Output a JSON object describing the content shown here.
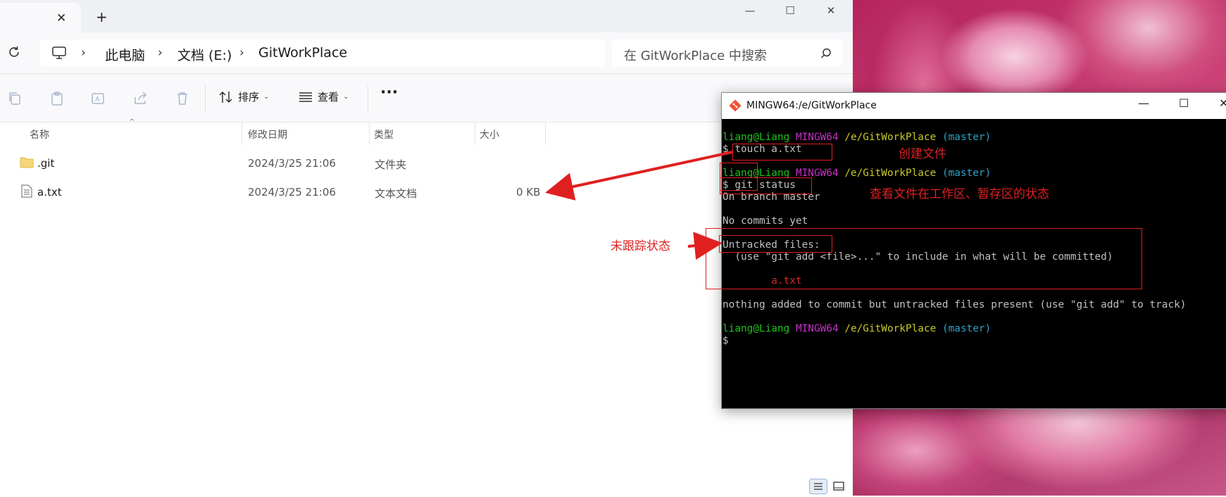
{
  "explorer": {
    "tab_close": "✕",
    "tab_add": "+",
    "window_controls": {
      "minimize": "—",
      "maximize": "☐",
      "close": "✕"
    },
    "breadcrumb": [
      "此电脑",
      "文档 (E:)",
      "GitWorkPlace"
    ],
    "search_placeholder": "在 GitWorkPlace 中搜索",
    "toolbar": {
      "sort_label": "排序",
      "view_label": "查看",
      "more_label": "···"
    },
    "columns": [
      "名称",
      "修改日期",
      "类型",
      "大小"
    ],
    "files": [
      {
        "name": ".git",
        "modified": "2024/3/25 21:06",
        "type": "文件夹",
        "size": "",
        "icon": "folder-icon"
      },
      {
        "name": "a.txt",
        "modified": "2024/3/25 21:06",
        "type": "文本文档",
        "size": "0 KB",
        "icon": "text-file-icon"
      }
    ]
  },
  "terminal": {
    "title": "MINGW64:/e/GitWorkPlace",
    "prompt_user": "liang@Liang",
    "prompt_env": "MINGW64",
    "prompt_path": "/e/GitWorkPlace",
    "prompt_branch": "(master)",
    "cmd1": "$ touch a.txt",
    "cmd2": "$ git status",
    "out1": "On branch master",
    "out2": "No commits yet",
    "out3": "Untracked files:",
    "out4": "  (use \"git add <file>...\" to include in what will be committed)",
    "out5": "        a.txt",
    "out6": "nothing added to commit but untracked files present (use \"git add\" to track)",
    "final_prompt": "$"
  },
  "annotations": {
    "create_file": "创建文件",
    "status_note": "查看文件在工作区、暂存区的状态",
    "untracked_note": "未跟踪状态"
  },
  "colors": {
    "annotation": "#e02020",
    "prompt_green": "#1fc21f",
    "prompt_magenta": "#c632c6",
    "prompt_yellow": "#c9c92a",
    "prompt_cyan": "#2aa3c9"
  }
}
